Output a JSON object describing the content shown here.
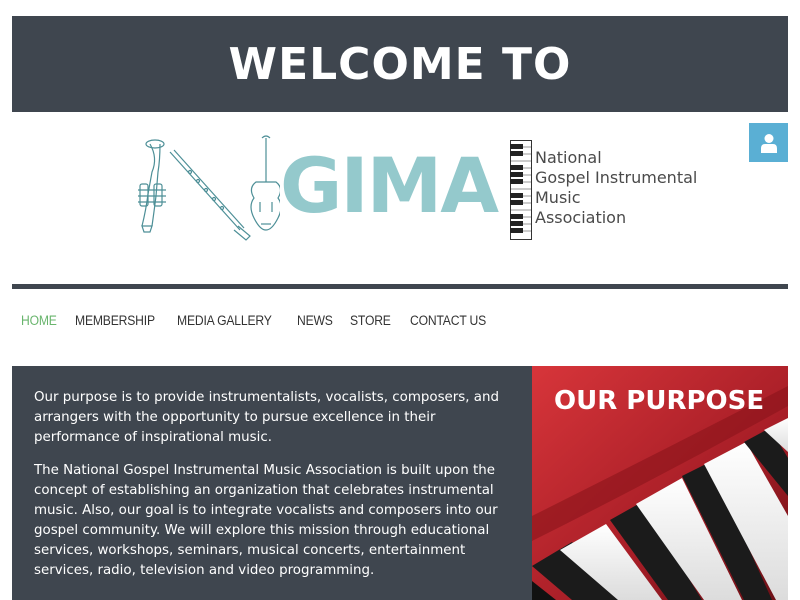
{
  "hero": {
    "title": "WELCOME TO"
  },
  "logo": {
    "acronym": "GIMA",
    "lines": [
      "National",
      "Gospel Instrumental",
      "Music",
      "Association"
    ]
  },
  "user_button": {
    "icon": "user-icon"
  },
  "nav": {
    "items": [
      {
        "label": "HOME",
        "active": true
      },
      {
        "label": "MEMBERSHIP",
        "active": false
      },
      {
        "label": "MEDIA GALLERY",
        "active": false
      },
      {
        "label": "NEWS",
        "active": false
      },
      {
        "label": "STORE",
        "active": false
      },
      {
        "label": "CONTACT US",
        "active": false
      }
    ]
  },
  "content": {
    "paragraph1": "Our purpose is to provide instrumentalists, vocalists, composers, and arrangers with the opportunity to pursue excellence in their performance of inspirational music.",
    "paragraph2": "The National Gospel Instrumental Music Association is built upon the concept of establishing an organization that celebrates instrumental music. Also, our goal is to integrate vocalists and composers into our gospel community. We will explore this mission through educational services, workshops, seminars, musical concerts, entertainment services, radio, television and video programming."
  },
  "purpose": {
    "title": "OUR PURPOSE"
  },
  "colors": {
    "dark": "#3f464f",
    "accent_blue": "#5aafd4",
    "logo_teal": "#94c9cc",
    "nav_active": "#69b56d",
    "keyboard_red": "#b8242c"
  }
}
